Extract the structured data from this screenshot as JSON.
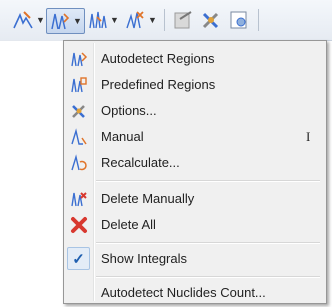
{
  "toolbar": {
    "buttons": [
      {
        "icon": "fit-peaks-icon"
      },
      {
        "icon": "regions-icon",
        "pressed": true
      },
      {
        "icon": "peaks-multiplet-icon"
      },
      {
        "icon": "peak-picking-icon"
      },
      {
        "icon": "edit-tool-icon"
      },
      {
        "icon": "options-tool-icon"
      },
      {
        "icon": "report-icon"
      }
    ]
  },
  "menu": {
    "items": [
      {
        "label": "Autodetect Regions",
        "icon": "autodetect-regions-icon"
      },
      {
        "label": "Predefined Regions",
        "icon": "predefined-regions-icon"
      },
      {
        "label": "Options...",
        "icon": "options-icon"
      },
      {
        "label": "Manual",
        "icon": "manual-region-icon",
        "shortcut": "I"
      },
      {
        "label": "Recalculate...",
        "icon": "recalculate-icon"
      },
      {
        "label": "Delete Manually",
        "icon": "delete-manually-icon"
      },
      {
        "label": "Delete All",
        "icon": "delete-all-icon"
      },
      {
        "label": "Show Integrals",
        "checked": true,
        "check_glyph": "✓"
      },
      {
        "label": "Autodetect Nuclides Count..."
      }
    ]
  },
  "colors": {
    "menu_bg": "#f0f0f0",
    "accent_blue": "#3b6fd1",
    "icon_orange": "#e0742a",
    "delete_red": "#d8382f"
  }
}
